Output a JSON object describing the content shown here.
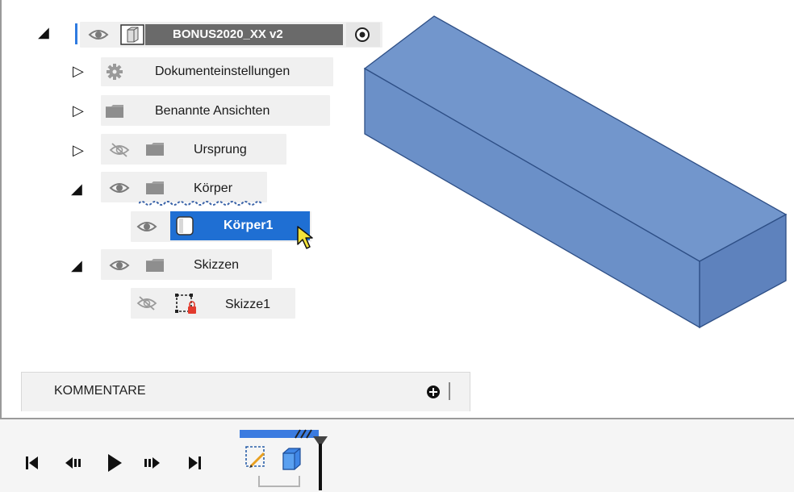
{
  "browser": {
    "root": {
      "name": "BONUS2020_XX v2",
      "expanded": true,
      "visible": true
    },
    "items": [
      {
        "label": "Dokumenteinstellungen",
        "icon": "gear-icon",
        "expanded": false
      },
      {
        "label": "Benannte Ansichten",
        "icon": "folder-icon",
        "expanded": false
      },
      {
        "label": "Ursprung",
        "icon": "folder-icon",
        "expanded": false,
        "visible": false
      },
      {
        "label": "Körper",
        "icon": "folder-icon",
        "expanded": true,
        "visible": true
      },
      {
        "label": "Körper1",
        "icon": "body-icon",
        "selected": true,
        "visible": true
      },
      {
        "label": "Skizzen",
        "icon": "folder-icon",
        "expanded": true,
        "visible": true
      },
      {
        "label": "Skizze1",
        "icon": "sketch-icon",
        "visible": false
      }
    ]
  },
  "comments": {
    "label": "KOMMENTARE"
  },
  "timeline": {
    "controls": [
      "go-to-start",
      "step-back",
      "play",
      "step-forward",
      "go-to-end"
    ]
  },
  "colors": {
    "selection": "#1f6fd3",
    "body_fill": "#6f97cf",
    "body_edge": "#2e4f86"
  }
}
